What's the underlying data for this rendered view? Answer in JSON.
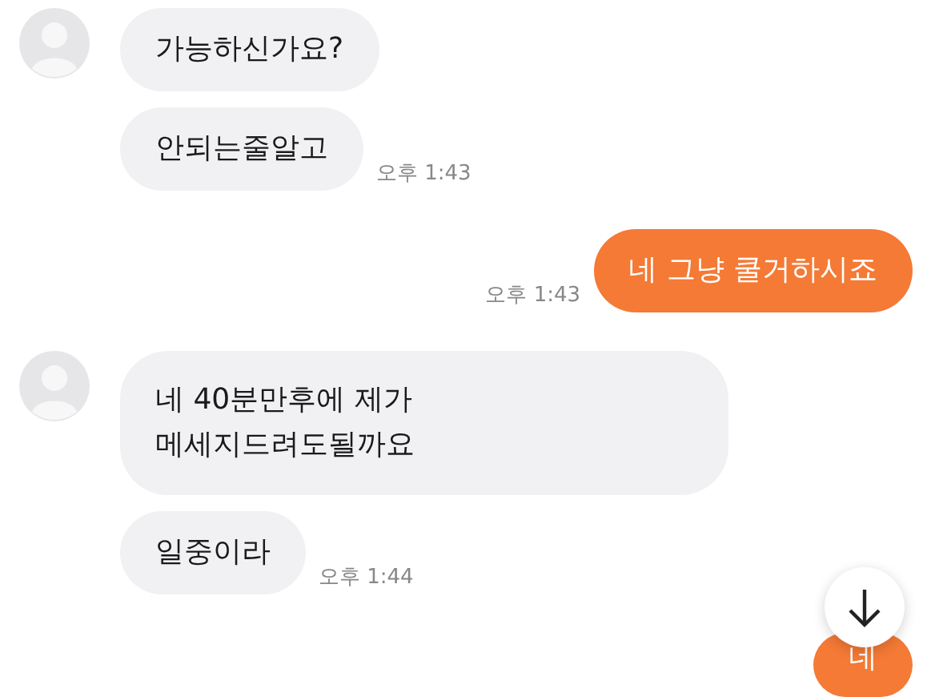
{
  "messages": [
    {
      "kind": "incoming",
      "show_avatar": true,
      "text": "가능하신가요?"
    },
    {
      "kind": "incoming",
      "show_avatar": false,
      "text": "안되는줄알고",
      "time": "오후 1:43"
    },
    {
      "kind": "outgoing",
      "text": "네 그냥 쿨거하시죠",
      "time": "오후 1:43"
    },
    {
      "kind": "incoming",
      "show_avatar": true,
      "text": "네 40분만후에 제가\n메세지드려도될까요"
    },
    {
      "kind": "incoming",
      "show_avatar": false,
      "text": "일중이라",
      "time": "오후 1:44"
    },
    {
      "kind": "outgoing",
      "text": "네"
    }
  ]
}
